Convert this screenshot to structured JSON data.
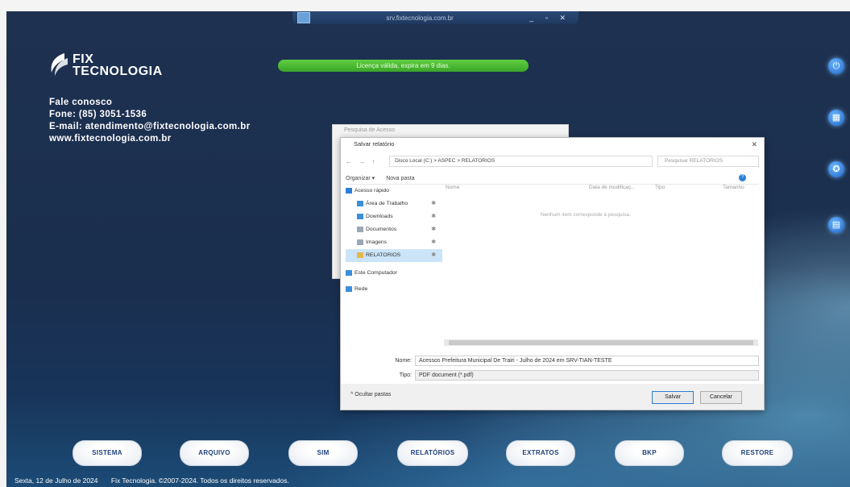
{
  "window": {
    "title": "srv.fixtecnologia.com.br",
    "controls": "_ ▫ ✕"
  },
  "brand": {
    "line1": "FIX",
    "line2": "TECNOLOGIA"
  },
  "contact": {
    "heading": "Fale conosco",
    "phone": "Fone: (85) 3051-1536",
    "email": "E-mail: atendimento@fixtecnologia.com.br",
    "website": "www.fixtecnologia.com.br"
  },
  "license_message": "Licença válida, expira em 9 dias.",
  "side_icons": [
    "power-icon",
    "calculator-icon",
    "support-icon",
    "report-icon"
  ],
  "back_dialog": {
    "title": "Pesquisa de Acesso"
  },
  "save_dialog": {
    "title": "Salvar relatório",
    "close": "✕",
    "nav_buttons": "← → ↑",
    "breadcrumb": "Disco Local (C:)  >  ASPEC  >  RELATORIOS",
    "search_placeholder": "Pesquisar RELATORIOS",
    "toolbar": {
      "organize": "Organizar ▾",
      "new_folder": "Nova pasta",
      "help": "?"
    },
    "nav_items": [
      {
        "label": "Acesso rápido",
        "color": "#2a7fd6"
      },
      {
        "label": "Área de Trabalho",
        "color": "#3b8fd9",
        "pin": "✱"
      },
      {
        "label": "Downloads",
        "color": "#3b8fd9",
        "pin": "✱"
      },
      {
        "label": "Documentos",
        "color": "#9aa7b6",
        "pin": "✱"
      },
      {
        "label": "Imagens",
        "color": "#9aa7b6",
        "pin": "✱"
      },
      {
        "label": "RELATORIOS",
        "color": "#e5b84a",
        "pin": "✱"
      },
      {
        "label": "Este Computador",
        "color": "#3b8fd9"
      },
      {
        "label": "Rede",
        "color": "#3b8fd9"
      }
    ],
    "columns": {
      "name": "Nome",
      "date": "Data de modificaç...",
      "type": "Tipo",
      "size": "Tamanho"
    },
    "empty_message": "Nenhum item corresponde à pesquisa.",
    "filename_label": "Nome:",
    "filename_value": "Acessos Prefeitura Municipal De Trairi - Julho de 2024 em SRV-TIAN-TESTE",
    "type_label": "Tipo:",
    "type_value": "PDF document (*.pdf)",
    "hide_folders": "^ Ocultar pastas",
    "save_button": "Salvar",
    "cancel_button": "Cancelar"
  },
  "bottom_menu": [
    "SISTEMA",
    "ARQUIVO",
    "SIM",
    "RELATÓRIOS",
    "EXTRATOS",
    "BKP",
    "RESTORE"
  ],
  "status_bar": {
    "date": "Sexta, 12 de Julho de 2024",
    "copyright": "Fix Tecnologia. ©2007-2024. Todos os direitos reservados."
  }
}
